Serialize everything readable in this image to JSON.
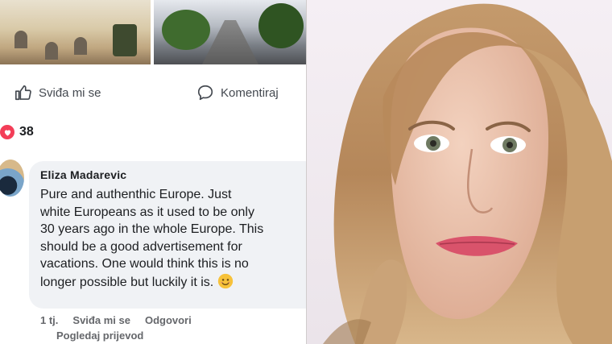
{
  "post": {
    "actions": {
      "like_label": "Sviđa mi se",
      "comment_label": "Komentiraj"
    },
    "reactions": {
      "count": "38"
    }
  },
  "comment": {
    "author": "Eliza Madarevic",
    "text": "Pure and authenthic Europe. Just\nwhite Europeans as it used to be only\n30 years ago in the whole Europe. This\nshould be a good advertisement for\nvacations. One would think this is no\nlonger possible but luckily it is. ",
    "emoji": "smiling-face",
    "meta": {
      "time": "1 tj.",
      "like_label": "Sviđa mi se",
      "reply_label": "Odgovori",
      "translate_label": "Pogledaj prijevod"
    }
  },
  "colors": {
    "heart": "#f33e58",
    "bubble": "#f0f2f5",
    "meta_text": "#65676b"
  }
}
